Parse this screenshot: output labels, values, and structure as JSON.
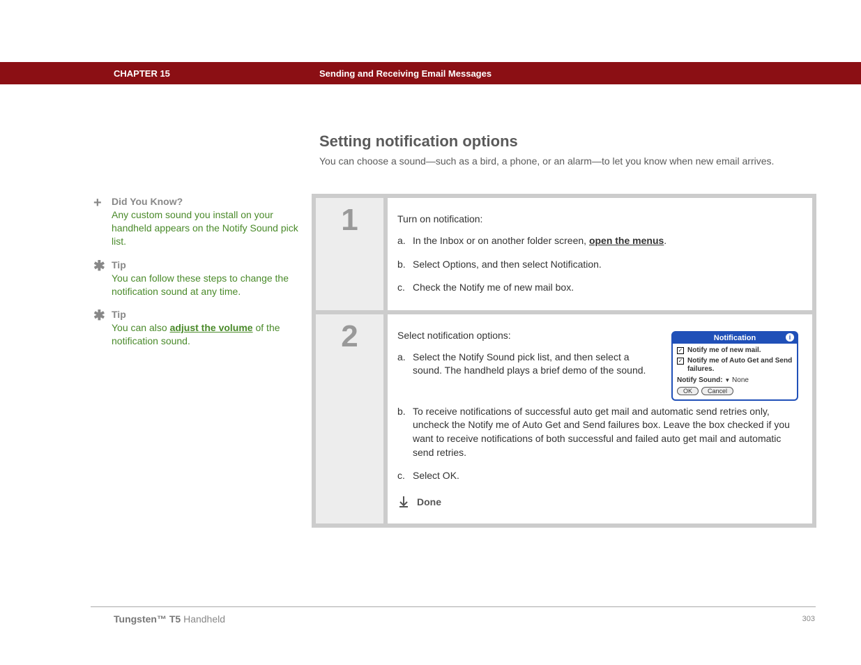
{
  "header": {
    "chapter_label": "CHAPTER 15",
    "chapter_title": "Sending and Receiving Email Messages"
  },
  "title": "Setting notification options",
  "intro": "You can choose a sound—such as a bird, a phone, or an alarm—to let you know when new email arrives.",
  "sidebar": [
    {
      "icon": "+",
      "heading": "Did You Know?",
      "body_before": "Any custom sound you install on your handheld appears on the Notify Sound pick list.",
      "link_text": "",
      "body_after": ""
    },
    {
      "icon": "✱",
      "heading": "Tip",
      "body_before": "You can follow these steps to change the notification sound at any time.",
      "link_text": "",
      "body_after": ""
    },
    {
      "icon": "✱",
      "heading": "Tip",
      "body_before": "You can also ",
      "link_text": "adjust the volume",
      "body_after": " of the notification sound."
    }
  ],
  "steps": {
    "step1": {
      "num": "1",
      "lead": "Turn on notification:",
      "items": [
        {
          "letter": "a.",
          "before": "In the Inbox or on another folder screen, ",
          "link": "open the menus",
          "after": "."
        },
        {
          "letter": "b.",
          "before": "Select Options, and then select Notification.",
          "link": "",
          "after": ""
        },
        {
          "letter": "c.",
          "before": "Check the Notify me of new mail box.",
          "link": "",
          "after": ""
        }
      ]
    },
    "step2": {
      "num": "2",
      "lead": "Select notification options:",
      "a": {
        "letter": "a.",
        "text": "Select the Notify Sound pick list, and then select a sound. The handheld plays a brief demo of the sound."
      },
      "b": {
        "letter": "b.",
        "text": "To receive notifications of successful auto get mail and automatic send retries only, uncheck the Notify me of Auto Get and Send failures box. Leave the box checked if you want to receive notifications of both successful and failed auto get mail and automatic send retries."
      },
      "c": {
        "letter": "c.",
        "text": "Select OK."
      },
      "done": "Done"
    }
  },
  "dialog": {
    "title": "Notification",
    "opt1": "Notify me of new mail.",
    "opt2": "Notify me of Auto Get and Send failures.",
    "sound_label": "Notify Sound:",
    "sound_value": "None",
    "ok": "OK",
    "cancel": "Cancel"
  },
  "footer": {
    "product_bold": "Tungsten™ T5",
    "product_rest": " Handheld",
    "page": "303"
  }
}
